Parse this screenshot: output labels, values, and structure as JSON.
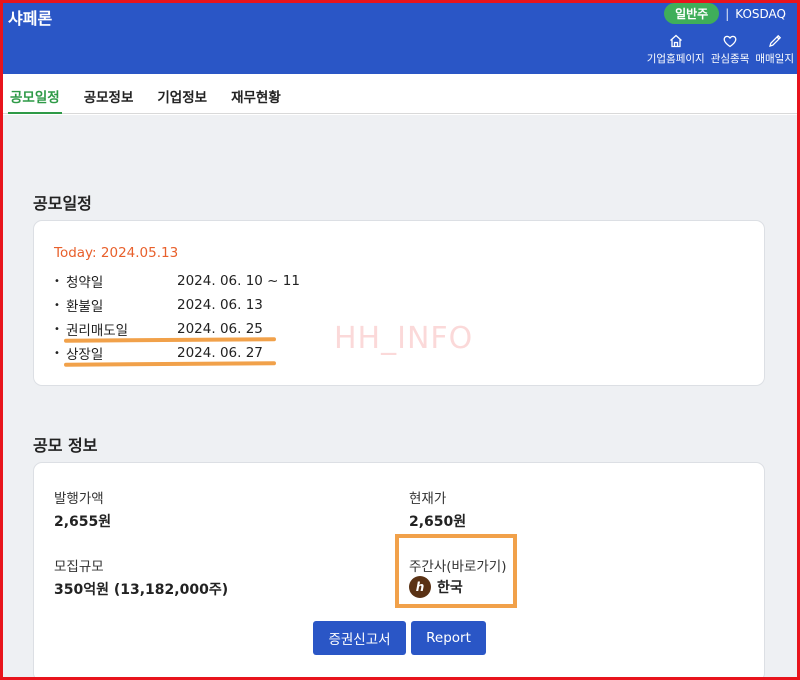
{
  "header": {
    "title": "샤페론",
    "stock_type_badge": "일반주",
    "separator": "|",
    "market": "KOSDAQ",
    "actions": [
      {
        "label": "기업홈페이지",
        "icon": "home-icon"
      },
      {
        "label": "관심종목",
        "icon": "heart-icon"
      },
      {
        "label": "매매일지",
        "icon": "pencil-icon"
      }
    ]
  },
  "tabs": [
    {
      "label": "공모일정",
      "active": true
    },
    {
      "label": "공모정보",
      "active": false
    },
    {
      "label": "기업정보",
      "active": false
    },
    {
      "label": "재무현황",
      "active": false
    }
  ],
  "schedule": {
    "title": "공모일정",
    "today": "Today: 2024.05.13",
    "items": [
      {
        "label": "청약일",
        "date": "2024. 06. 10 ~ 11"
      },
      {
        "label": "환불일",
        "date": "2024. 06. 13"
      },
      {
        "label": "권리매도일",
        "date": "2024. 06. 25"
      },
      {
        "label": "상장일",
        "date": "2024. 06. 27"
      }
    ],
    "watermark": "HH_INFO"
  },
  "offering": {
    "title": "공모 정보",
    "issue_price_label": "발행가액",
    "issue_price_value": "2,655원",
    "current_price_label": "현재가",
    "current_price_value": "2,650원",
    "size_label": "모집규모",
    "size_value": "350억원 (13,182,000주)",
    "underwriter_label": "주간사(바로가기)",
    "underwriter_value": "한국",
    "underwriter_logo_letter": "h",
    "buttons": {
      "filing": "증권신고서",
      "report": "Report"
    }
  },
  "colors": {
    "header_blue": "#2a56c6",
    "active_tab_green": "#2e9a47",
    "today_orange": "#e8602c",
    "annotation_orange": "#f1a14a",
    "frame_red": "#e8141c"
  }
}
